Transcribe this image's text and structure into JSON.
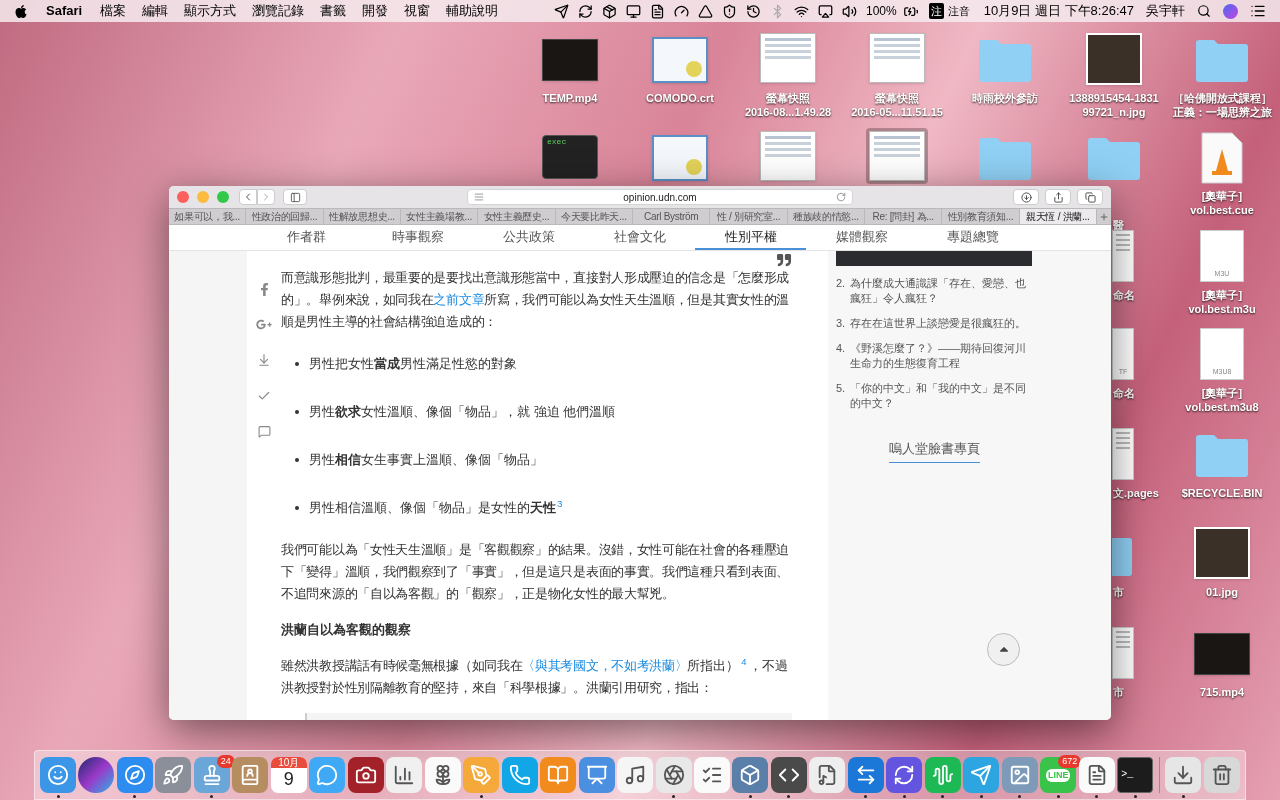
{
  "menu_bar": {
    "app_name": "Safari",
    "menus": [
      "檔案",
      "編輯",
      "顯示方式",
      "瀏覽記錄",
      "書籤",
      "開發",
      "視窗",
      "輔助說明"
    ],
    "battery": "100%",
    "input_badge": "注",
    "input_method": "注音",
    "clock": "10月9日 週日 下午8:26:47",
    "user": "吳宇軒"
  },
  "desktop_icons": [
    {
      "kind": "video",
      "label": [
        "TEMP.mp4"
      ],
      "selected": false
    },
    {
      "kind": "certificate",
      "label": [
        "COMODO.crt"
      ],
      "selected": false
    },
    {
      "kind": "screenshot",
      "label": [
        "螢幕快照",
        "2016-08...1.49.28"
      ],
      "selected": false
    },
    {
      "kind": "screenshot",
      "label": [
        "螢幕快照",
        "2016-05...11.51.15"
      ],
      "selected": false
    },
    {
      "kind": "folder",
      "label": [
        "時雨校外參訪"
      ],
      "selected": false
    },
    {
      "kind": "photo",
      "label": [
        "1388915454-1831",
        "99721_n.jpg"
      ],
      "selected": false
    },
    {
      "kind": "folder",
      "label": [
        "［哈佛開放式課程］",
        "正義：一場思辨之旅"
      ],
      "selected": false
    },
    {
      "kind": "terminal",
      "glyph": "exec",
      "selected": false
    },
    {
      "kind": "certificate",
      "selected": false
    },
    {
      "kind": "screenshot",
      "selected": false
    },
    {
      "kind": "screenshot",
      "selected": true
    },
    {
      "kind": "folder",
      "selected": false
    },
    {
      "kind": "folder",
      "label": [
        "醫"
      ],
      "selected": false
    },
    {
      "kind": "vlc",
      "label": [
        "[奧華子]",
        "vol.best.cue"
      ],
      "selected": false
    },
    {
      "kind": "document",
      "label": [
        "命名"
      ],
      "selected": false
    },
    {
      "kind": "playlist",
      "glyph": "M3U",
      "label": [
        "[奧華子]",
        "vol.best.m3u"
      ],
      "selected": false
    },
    {
      "kind": "playlist",
      "glyph": "TF",
      "label": [
        "命名"
      ],
      "selected": false
    },
    {
      "kind": "playlist",
      "glyph": "M3U8",
      "label": [
        "[奧華子]",
        "vol.best.m3u8"
      ],
      "selected": false
    },
    {
      "kind": "document",
      "label": [
        "文.pages"
      ],
      "selected": false
    },
    {
      "kind": "folder",
      "label": [
        "$RECYCLE.BIN"
      ],
      "selected": false
    },
    {
      "kind": "folder",
      "label": [
        "市"
      ],
      "selected": false
    },
    {
      "kind": "photo",
      "label": [
        "01.jpg"
      ],
      "selected": false
    },
    {
      "kind": "document",
      "label": [
        "市"
      ],
      "selected": false
    },
    {
      "kind": "video",
      "label": [
        "715.mp4"
      ],
      "selected": false
    }
  ],
  "browser": {
    "url": "opinion.udn.com",
    "tabs": [
      {
        "label": "如果可以，我...",
        "selected": false
      },
      {
        "label": "性政治的回歸...",
        "selected": false
      },
      {
        "label": "性解放思想史...",
        "selected": false
      },
      {
        "label": "女性主義場教...",
        "selected": false
      },
      {
        "label": "女性主義歷史...",
        "selected": false
      },
      {
        "label": "今天要比昨天...",
        "selected": false
      },
      {
        "label": "Carl Byström",
        "selected": false
      },
      {
        "label": "性 / 別研究室...",
        "selected": false
      },
      {
        "label": "種族歧的情慾...",
        "selected": false
      },
      {
        "label": "Re: [問卦] 為...",
        "selected": false
      },
      {
        "label": "性別教育須知...",
        "selected": false
      },
      {
        "label": "親天恆 / 洪蘭...",
        "selected": true
      }
    ],
    "nav": [
      {
        "label": "作者群",
        "selected": false
      },
      {
        "label": "時事觀察",
        "selected": false
      },
      {
        "label": "公共政策",
        "selected": false
      },
      {
        "label": "社會文化",
        "selected": false
      },
      {
        "label": "性別平權",
        "selected": true
      },
      {
        "label": "媒體觀察",
        "selected": false
      },
      {
        "label": "專題總覽",
        "selected": false
      }
    ],
    "article": [
      {
        "kind": "paragraph",
        "parts": [
          {
            "kind": "text",
            "text": "而意識形態批判，最重要的是要找出意識形態當中，直接對人形成壓迫的信念是「怎麼形成的」。舉例來說，如同我在"
          },
          {
            "kind": "link",
            "text": "之前文章"
          },
          {
            "kind": "text",
            "text": "所寫，我們可能以為女性天生溫順，但是其實女性的溫順是男性主導的社會結構強迫造成的："
          }
        ]
      },
      {
        "kind": "bullet",
        "text": "男性把女性**當成**男性滿足性慾的對象"
      },
      {
        "kind": "bullet",
        "text": "男性**欲求**女性溫順、像個「物品」，就 強迫 他們溫順"
      },
      {
        "kind": "bullet",
        "text": "男性**相信**女生事實上溫順、像個「物品」"
      },
      {
        "kind": "bullet",
        "text": "男性相信溫順、像個「物品」是女性的**天性**",
        "note": "3"
      },
      {
        "kind": "paragraph",
        "parts": [
          {
            "kind": "text",
            "text": "我們可能以為「女性天生溫順」是「客觀觀察」的結果。沒錯，女性可能在社會的各種壓迫下「變得」溫順，我們觀察到了「事實」，但是這只是表面的事實。我們這種只看到表面、不追問來源的「自以為客觀」的「觀察」，正是物化女性的最大幫兇。"
          }
        ]
      },
      {
        "kind": "heading",
        "text": "洪蘭自以為客觀的觀察"
      },
      {
        "kind": "paragraph",
        "parts": [
          {
            "kind": "text",
            "text": "雖然洪教授講話有時候毫無根據（如同我在"
          },
          {
            "kind": "link",
            "text": "〈與其考國文，不如考洪蘭〉"
          },
          {
            "kind": "text",
            "text": "所指出）"
          },
          {
            "kind": "note",
            "text": "4"
          },
          {
            "kind": "text",
            "text": "，不過洪教授對於性別隔離教育的堅持，來自「科學根據」。洪蘭引用研究，指出："
          }
        ]
      },
      {
        "kind": "quote"
      }
    ],
    "sidebar": {
      "related": [
        {
          "number": "2.",
          "text": "為什麼成大通識課「存在、愛戀、也瘋狂」令人瘋狂？"
        },
        {
          "number": "3.",
          "text": "存在在這世界上談戀愛是很瘋狂的。"
        },
        {
          "number": "4.",
          "text": "《野溪怎麼了？》——期待回復河川生命力的生態復育工程"
        },
        {
          "number": "5.",
          "text": "「你的中文」和「我的中文」是不同的中文？"
        }
      ],
      "page_link": "嗚人堂臉書專頁"
    }
  },
  "dock": [
    {
      "kind": "finder",
      "running": true
    },
    {
      "kind": "siri",
      "running": false
    },
    {
      "kind": "safari",
      "running": true
    },
    {
      "kind": "launchpad",
      "running": false
    },
    {
      "kind": "stamp",
      "running": true,
      "badge": "24"
    },
    {
      "kind": "contacts",
      "running": false
    },
    {
      "kind": "calendar",
      "running": false,
      "month": "10月",
      "day": "9"
    },
    {
      "kind": "messages",
      "running": false
    },
    {
      "kind": "photobooth",
      "running": false
    },
    {
      "kind": "numbers",
      "running": false
    },
    {
      "kind": "photos",
      "running": false
    },
    {
      "kind": "pages",
      "running": true
    },
    {
      "kind": "skype",
      "running": false
    },
    {
      "kind": "books",
      "running": false
    },
    {
      "kind": "keynote",
      "running": false
    },
    {
      "kind": "music",
      "running": false
    },
    {
      "kind": "chrome",
      "running": true
    },
    {
      "kind": "reminders",
      "running": false
    },
    {
      "kind": "virtualbox",
      "running": true
    },
    {
      "kind": "sublime",
      "running": true
    },
    {
      "kind": "score",
      "running": false
    },
    {
      "kind": "teamviewer",
      "running": true
    },
    {
      "kind": "sync",
      "running": true
    },
    {
      "kind": "spotify",
      "running": true
    },
    {
      "kind": "telegram",
      "running": true
    },
    {
      "kind": "preview",
      "running": true
    },
    {
      "kind": "line",
      "running": true,
      "badge": "672",
      "glyph": "LINE"
    },
    {
      "kind": "textedit",
      "running": true
    },
    {
      "kind": "terminal",
      "running": true,
      "glyph": ">_"
    },
    {
      "kind": "separator"
    },
    {
      "kind": "downloads",
      "running": true
    },
    {
      "kind": "trash",
      "running": false
    }
  ]
}
